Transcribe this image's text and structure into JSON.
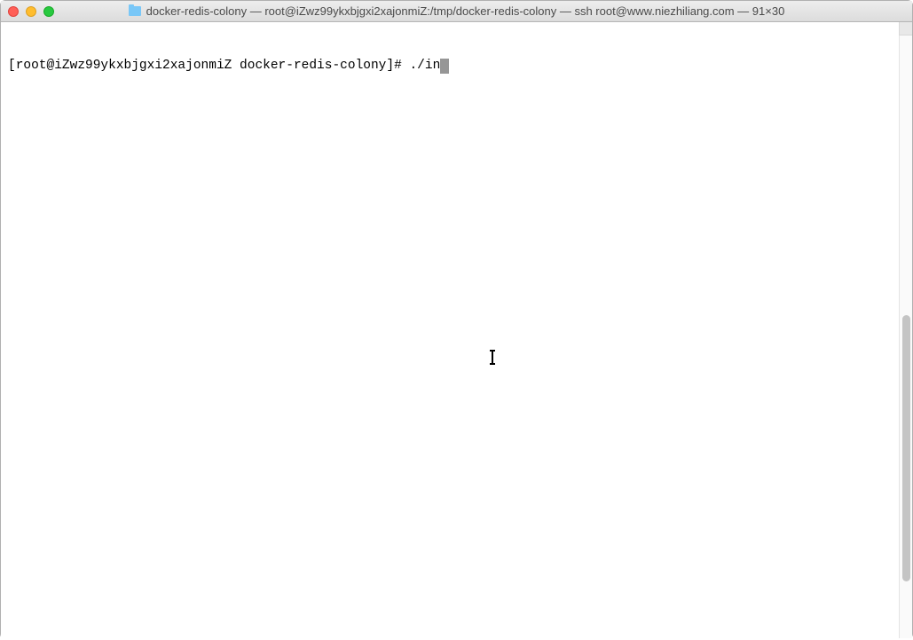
{
  "window": {
    "title": "docker-redis-colony — root@iZwz99ykxbjgxi2xajonmiZ:/tmp/docker-redis-colony — ssh root@www.niezhiliang.com — 91×30"
  },
  "terminal": {
    "prompt": "[root@iZwz99ykxbjgxi2xajonmiZ docker-redis-colony]# ",
    "command": "./in"
  }
}
